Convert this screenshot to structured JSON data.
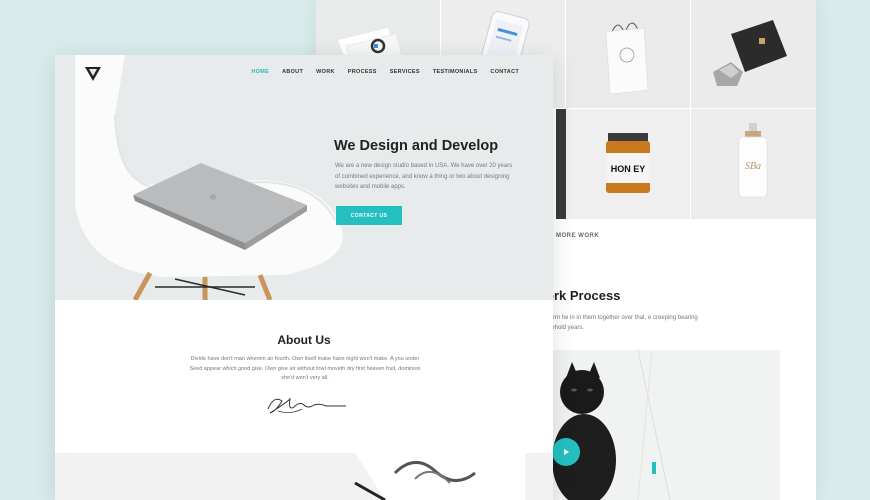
{
  "back": {
    "more_work_label": "MORE WORK",
    "process_title": "ork Process",
    "process_text": "form he in in them together over that, e creeping bearing behold years.",
    "honey_label": "HON EY",
    "cosmetic_label": "SBa"
  },
  "front": {
    "nav": [
      "HOME",
      "ABOUT",
      "WORK",
      "PROCESS",
      "SERVICES",
      "TESTIMONIALS",
      "CONTACT"
    ],
    "hero": {
      "title": "We Design and Develop",
      "text": "We are a new design studio based in USA. We have over 20 years of combined experience, and know a thing or two about designing websites and mobile apps.",
      "button": "CONTACT US"
    },
    "about": {
      "title": "About Us",
      "text": "Divide have don't man wherein air fourth. Own itself make have night won't make. A you under Seed appear which good give. Own give air without fowl moveth dry first heaven fruit, dominion she'd won't very all."
    }
  },
  "colors": {
    "accent": "#24c0c0",
    "background": "#d9ecec"
  }
}
